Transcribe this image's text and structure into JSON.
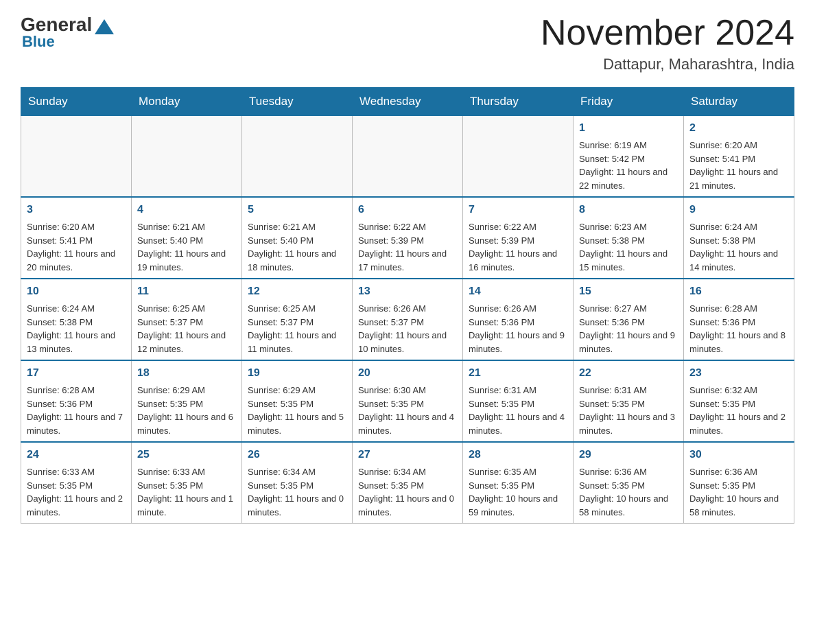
{
  "header": {
    "logo_general": "General",
    "logo_blue": "Blue",
    "month_title": "November 2024",
    "location": "Dattapur, Maharashtra, India"
  },
  "days_of_week": [
    "Sunday",
    "Monday",
    "Tuesday",
    "Wednesday",
    "Thursday",
    "Friday",
    "Saturday"
  ],
  "weeks": [
    [
      {
        "day": "",
        "info": ""
      },
      {
        "day": "",
        "info": ""
      },
      {
        "day": "",
        "info": ""
      },
      {
        "day": "",
        "info": ""
      },
      {
        "day": "",
        "info": ""
      },
      {
        "day": "1",
        "info": "Sunrise: 6:19 AM\nSunset: 5:42 PM\nDaylight: 11 hours and 22 minutes."
      },
      {
        "day": "2",
        "info": "Sunrise: 6:20 AM\nSunset: 5:41 PM\nDaylight: 11 hours and 21 minutes."
      }
    ],
    [
      {
        "day": "3",
        "info": "Sunrise: 6:20 AM\nSunset: 5:41 PM\nDaylight: 11 hours and 20 minutes."
      },
      {
        "day": "4",
        "info": "Sunrise: 6:21 AM\nSunset: 5:40 PM\nDaylight: 11 hours and 19 minutes."
      },
      {
        "day": "5",
        "info": "Sunrise: 6:21 AM\nSunset: 5:40 PM\nDaylight: 11 hours and 18 minutes."
      },
      {
        "day": "6",
        "info": "Sunrise: 6:22 AM\nSunset: 5:39 PM\nDaylight: 11 hours and 17 minutes."
      },
      {
        "day": "7",
        "info": "Sunrise: 6:22 AM\nSunset: 5:39 PM\nDaylight: 11 hours and 16 minutes."
      },
      {
        "day": "8",
        "info": "Sunrise: 6:23 AM\nSunset: 5:38 PM\nDaylight: 11 hours and 15 minutes."
      },
      {
        "day": "9",
        "info": "Sunrise: 6:24 AM\nSunset: 5:38 PM\nDaylight: 11 hours and 14 minutes."
      }
    ],
    [
      {
        "day": "10",
        "info": "Sunrise: 6:24 AM\nSunset: 5:38 PM\nDaylight: 11 hours and 13 minutes."
      },
      {
        "day": "11",
        "info": "Sunrise: 6:25 AM\nSunset: 5:37 PM\nDaylight: 11 hours and 12 minutes."
      },
      {
        "day": "12",
        "info": "Sunrise: 6:25 AM\nSunset: 5:37 PM\nDaylight: 11 hours and 11 minutes."
      },
      {
        "day": "13",
        "info": "Sunrise: 6:26 AM\nSunset: 5:37 PM\nDaylight: 11 hours and 10 minutes."
      },
      {
        "day": "14",
        "info": "Sunrise: 6:26 AM\nSunset: 5:36 PM\nDaylight: 11 hours and 9 minutes."
      },
      {
        "day": "15",
        "info": "Sunrise: 6:27 AM\nSunset: 5:36 PM\nDaylight: 11 hours and 9 minutes."
      },
      {
        "day": "16",
        "info": "Sunrise: 6:28 AM\nSunset: 5:36 PM\nDaylight: 11 hours and 8 minutes."
      }
    ],
    [
      {
        "day": "17",
        "info": "Sunrise: 6:28 AM\nSunset: 5:36 PM\nDaylight: 11 hours and 7 minutes."
      },
      {
        "day": "18",
        "info": "Sunrise: 6:29 AM\nSunset: 5:35 PM\nDaylight: 11 hours and 6 minutes."
      },
      {
        "day": "19",
        "info": "Sunrise: 6:29 AM\nSunset: 5:35 PM\nDaylight: 11 hours and 5 minutes."
      },
      {
        "day": "20",
        "info": "Sunrise: 6:30 AM\nSunset: 5:35 PM\nDaylight: 11 hours and 4 minutes."
      },
      {
        "day": "21",
        "info": "Sunrise: 6:31 AM\nSunset: 5:35 PM\nDaylight: 11 hours and 4 minutes."
      },
      {
        "day": "22",
        "info": "Sunrise: 6:31 AM\nSunset: 5:35 PM\nDaylight: 11 hours and 3 minutes."
      },
      {
        "day": "23",
        "info": "Sunrise: 6:32 AM\nSunset: 5:35 PM\nDaylight: 11 hours and 2 minutes."
      }
    ],
    [
      {
        "day": "24",
        "info": "Sunrise: 6:33 AM\nSunset: 5:35 PM\nDaylight: 11 hours and 2 minutes."
      },
      {
        "day": "25",
        "info": "Sunrise: 6:33 AM\nSunset: 5:35 PM\nDaylight: 11 hours and 1 minute."
      },
      {
        "day": "26",
        "info": "Sunrise: 6:34 AM\nSunset: 5:35 PM\nDaylight: 11 hours and 0 minutes."
      },
      {
        "day": "27",
        "info": "Sunrise: 6:34 AM\nSunset: 5:35 PM\nDaylight: 11 hours and 0 minutes."
      },
      {
        "day": "28",
        "info": "Sunrise: 6:35 AM\nSunset: 5:35 PM\nDaylight: 10 hours and 59 minutes."
      },
      {
        "day": "29",
        "info": "Sunrise: 6:36 AM\nSunset: 5:35 PM\nDaylight: 10 hours and 58 minutes."
      },
      {
        "day": "30",
        "info": "Sunrise: 6:36 AM\nSunset: 5:35 PM\nDaylight: 10 hours and 58 minutes."
      }
    ]
  ]
}
